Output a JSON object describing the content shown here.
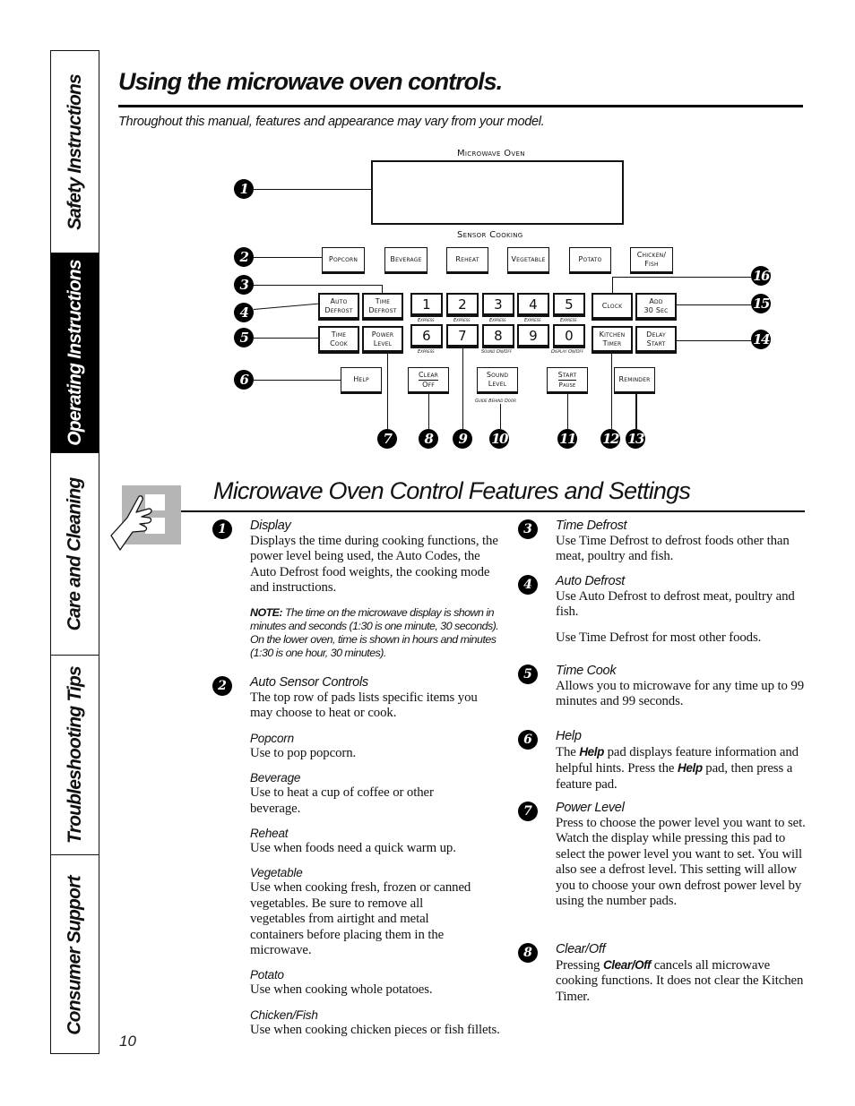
{
  "side_tabs": [
    {
      "label": "Safety Instructions",
      "active": false
    },
    {
      "label": "Operating Instructions",
      "active": true
    },
    {
      "label": "Care and Cleaning",
      "active": false
    },
    {
      "label": "Troubleshooting Tips",
      "active": false
    },
    {
      "label": "Consumer Support",
      "active": false
    }
  ],
  "header": {
    "title": "Using the microwave oven controls.",
    "subtitle": "Throughout this manual, features and appearance may vary from your model."
  },
  "diagram": {
    "display_label": "Microwave Oven",
    "sensor_label": "Sensor Cooking",
    "sensor_pads": [
      "Popcorn",
      "Beverage",
      "Reheat",
      "Vegetable",
      "Potato"
    ],
    "chicken_fish": [
      "Chicken/",
      "Fish"
    ],
    "auto_defrost": [
      "Auto",
      "Defrost"
    ],
    "time_defrost": [
      "Time",
      "Defrost"
    ],
    "time_cook": [
      "Time",
      "Cook"
    ],
    "power_level": [
      "Power",
      "Level"
    ],
    "numbers_row1": [
      "1",
      "2",
      "3",
      "4",
      "5"
    ],
    "numbers_row2": [
      "6",
      "7",
      "8",
      "9",
      "0"
    ],
    "sublabels_row1": [
      "Express",
      "Express",
      "Express",
      "Express",
      "Express"
    ],
    "sublabels_row2": {
      "6": "Express",
      "8": "Sound On/Off",
      "0": "Display On/Off"
    },
    "clock": "Clock",
    "add_30": [
      "Add",
      "30 Sec"
    ],
    "kitchen_timer": [
      "Kitchen",
      "Timer"
    ],
    "delay_start": [
      "Delay",
      "Start"
    ],
    "help": "Help",
    "clear_off": [
      "Clear",
      "Off"
    ],
    "sound_level": [
      "Sound",
      "Level"
    ],
    "guide_behind_door": "Guide Behind Door",
    "start_pause": [
      "Start",
      "Pause"
    ],
    "reminder": "Reminder",
    "callouts": [
      "1",
      "2",
      "3",
      "4",
      "5",
      "6",
      "7",
      "8",
      "9",
      "10",
      "11",
      "12",
      "13",
      "14",
      "15",
      "16"
    ]
  },
  "section": {
    "title": "Microwave Oven Control Features and Settings"
  },
  "features": {
    "display": {
      "num": "1",
      "title": "Display",
      "body": "Displays the time during cooking functions, the power level being used, the Auto Codes, the Auto Defrost food weights, the cooking mode and instructions.",
      "note_label": "NOTE:",
      "note": " The time on the microwave display is shown in minutes and seconds (1:30 is one minute, 30 seconds). On the lower oven, time is shown in hours and minutes (1:30 is one hour, 30 minutes)."
    },
    "auto_sensor": {
      "num": "2",
      "title": "Auto Sensor Controls",
      "body": "The top row of pads lists specific items you may choose to heat or cook.",
      "items": [
        {
          "title": "Popcorn",
          "body": "Use to pop popcorn."
        },
        {
          "title": "Beverage",
          "body": "Use to heat a cup of coffee or other beverage."
        },
        {
          "title": "Reheat",
          "body": "Use when foods need a quick warm up."
        },
        {
          "title": "Vegetable",
          "body": "Use when cooking fresh, frozen or canned vegetables. Be sure to remove all vegetables from airtight and metal containers before placing them in the microwave."
        },
        {
          "title": "Potato",
          "body": "Use when cooking whole potatoes."
        },
        {
          "title": "Chicken/Fish",
          "body": "Use when cooking chicken pieces or fish fillets."
        }
      ]
    },
    "time_defrost": {
      "num": "3",
      "title": "Time Defrost",
      "body": "Use Time Defrost to defrost foods other than meat, poultry and fish."
    },
    "auto_defrost": {
      "num": "4",
      "title": "Auto Defrost",
      "body": "Use Auto Defrost to defrost meat, poultry and fish.",
      "body2": "Use Time Defrost for most other foods."
    },
    "time_cook": {
      "num": "5",
      "title": "Time Cook",
      "body": "Allows you to microwave for any time up to 99 minutes and 99 seconds."
    },
    "help": {
      "num": "6",
      "title": "Help",
      "pre": "The ",
      "bold1": "Help",
      "mid": " pad displays feature information and helpful hints. Press the ",
      "bold2": "Help",
      "post": " pad, then press a feature pad."
    },
    "power_level": {
      "num": "7",
      "title": "Power Level",
      "body": "Press to choose the power level you want to set. Watch the display while pressing this pad to select the power level you want to set. You will also see a defrost level. This setting will allow you to choose your own defrost power level by using the number pads."
    },
    "clear_off": {
      "num": "8",
      "title": "Clear/Off",
      "pre": "Pressing ",
      "bold": "Clear/Off",
      "post": " cancels all microwave cooking functions. It does not clear the Kitchen Timer."
    }
  },
  "page_number": "10"
}
